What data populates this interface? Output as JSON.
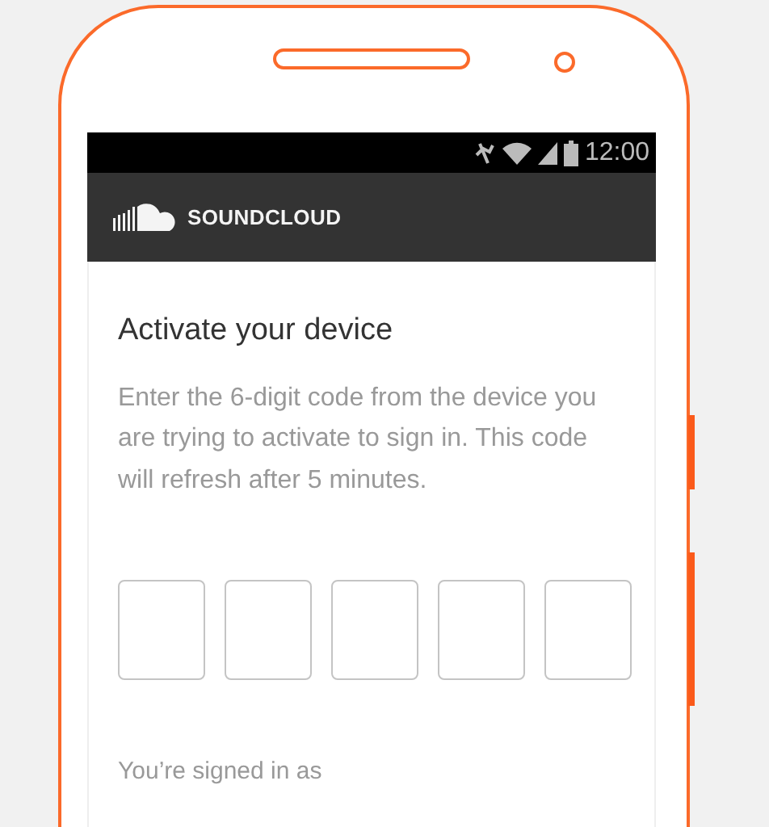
{
  "status_bar": {
    "time": "12:00"
  },
  "app_bar": {
    "brand": "SOUNDCLOUD"
  },
  "title": "Activate your device",
  "description": "Enter the 6-digit code from the device you are trying to activate to sign in. This code will refresh after 5 minutes.",
  "code_boxes": [
    {
      "kind": "digit"
    },
    {
      "kind": "digit"
    },
    {
      "kind": "digit"
    },
    {
      "kind": "digit"
    },
    {
      "kind": "digit"
    }
  ],
  "signed_in_text": "You’re signed in as"
}
